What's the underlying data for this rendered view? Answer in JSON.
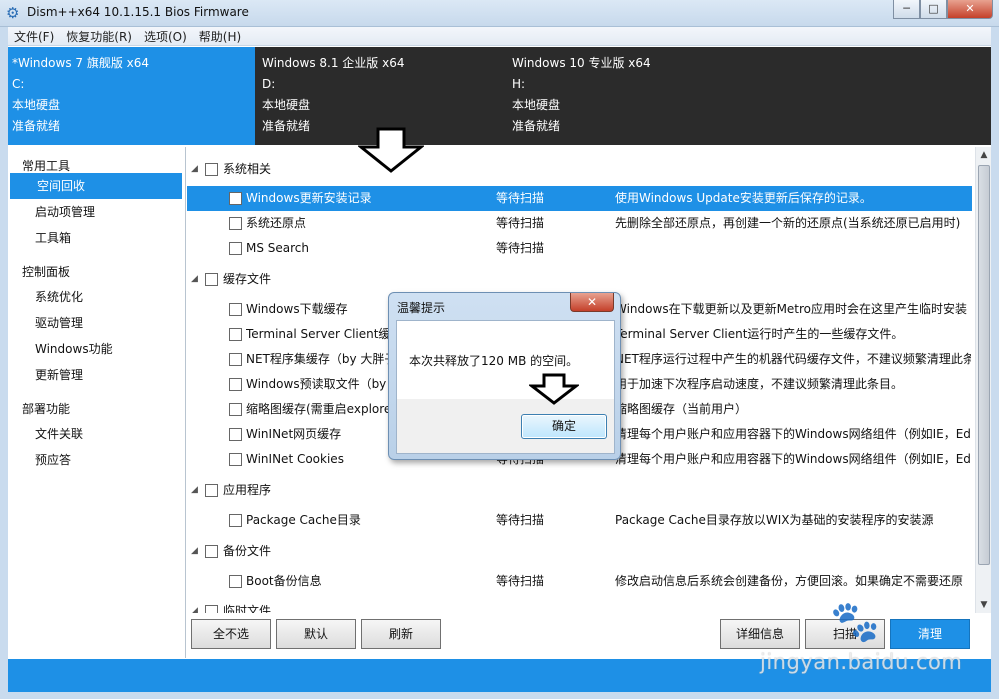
{
  "window": {
    "title": "Dism++x64 10.1.15.1 Bios Firmware",
    "min_label": "─",
    "max_label": "□",
    "close_label": "✕"
  },
  "menu": [
    "文件(F)",
    "恢复功能(R)",
    "选项(O)",
    "帮助(H)"
  ],
  "systems": [
    {
      "name": "*Windows 7 旗舰版 x64",
      "drive": "C:",
      "disk": "本地硬盘",
      "status": "准备就绪",
      "active": true
    },
    {
      "name": "Windows 8.1 企业版 x64",
      "drive": "D:",
      "disk": "本地硬盘",
      "status": "准备就绪",
      "active": false
    },
    {
      "name": "Windows 10 专业版 x64",
      "drive": "H:",
      "disk": "本地硬盘",
      "status": "准备就绪",
      "active": false
    }
  ],
  "sidebar": {
    "groups": [
      {
        "title": "常用工具",
        "items": [
          "空间回收",
          "启动项管理",
          "工具箱"
        ]
      },
      {
        "title": "控制面板",
        "items": [
          "系统优化",
          "驱动管理",
          "Windows功能",
          "更新管理"
        ]
      },
      {
        "title": "部署功能",
        "items": [
          "文件关联",
          "预应答"
        ]
      }
    ],
    "selected": "空间回收"
  },
  "content": {
    "categories": [
      {
        "title": "系统相关",
        "items": [
          {
            "name": "Windows更新安装记录",
            "status": "等待扫描",
            "desc": "使用Windows Update安装更新后保存的记录。",
            "selected": true
          },
          {
            "name": "系统还原点",
            "status": "等待扫描",
            "desc": "先删除全部还原点，再创建一个新的还原点(当系统还原已启用时)"
          },
          {
            "name": "MS Search",
            "status": "等待扫描",
            "desc": ""
          }
        ]
      },
      {
        "title": "缓存文件",
        "items": [
          {
            "name": "Windows下载缓存",
            "status": "",
            "desc": "Windows在下载更新以及更新Metro应用时会在这里产生临时安装"
          },
          {
            "name": "Terminal Server Client缓存",
            "status": "",
            "desc": "Terminal Server Client运行时产生的一些缓存文件。"
          },
          {
            "name": "NET程序集缓存（by 大胖子）",
            "status": "",
            "desc": "NET程序运行过程中产生的机器代码缓存文件，不建议频繁清理此条"
          },
          {
            "name": "Windows预读取文件（by 大胖子）",
            "status": "",
            "desc": "用于加速下次程序启动速度，不建议频繁清理此条目。"
          },
          {
            "name": "缩略图缓存(需重启explorer)",
            "status": "",
            "desc": "缩略图缓存（当前用户）"
          },
          {
            "name": "WinINet网页缓存",
            "status": "",
            "desc": "清理每个用户账户和应用容器下的Windows网络组件（例如IE，Ed"
          },
          {
            "name": "WinINet Cookies",
            "status": "等待扫描",
            "desc": "清理每个用户账户和应用容器下的Windows网络组件（例如IE，Ed"
          }
        ]
      },
      {
        "title": "应用程序",
        "items": [
          {
            "name": "Package Cache目录",
            "status": "等待扫描",
            "desc": "Package Cache目录存放以WIX为基础的安装程序的安装源"
          }
        ]
      },
      {
        "title": "备份文件",
        "items": [
          {
            "name": "Boot备份信息",
            "status": "等待扫描",
            "desc": "修改启动信息后系统会创建备份，方便回滚。如果确定不需要还原"
          }
        ]
      },
      {
        "title": "临时文件",
        "items": []
      }
    ]
  },
  "buttons": {
    "deselect_all": "全不选",
    "default": "默认",
    "refresh": "刷新",
    "details": "详细信息",
    "scan": "扫描",
    "clean": "清理"
  },
  "dialog": {
    "title": "温馨提示",
    "message": "本次共释放了120 MB 的空间。",
    "ok": "确定",
    "close": "✕"
  },
  "watermark": {
    "text": "jingyan.baidu.com"
  }
}
